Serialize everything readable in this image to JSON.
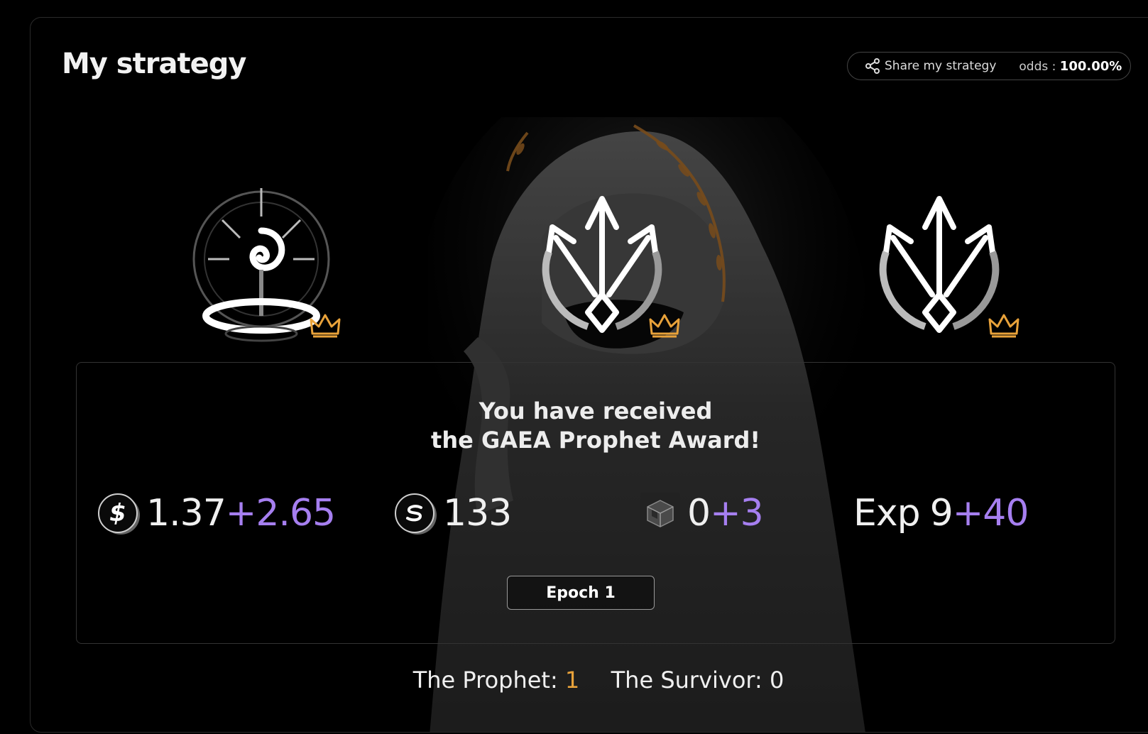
{
  "header": {
    "title": "My strategy",
    "share_label": "Share my strategy",
    "odds_label": "odds :",
    "odds_value": "100.00%"
  },
  "emblems": [
    {
      "name": "spiral-sun-emblem",
      "crown": "crown-icon"
    },
    {
      "name": "trident-emblem",
      "crown": "crown-icon"
    },
    {
      "name": "trident-emblem",
      "crown": "crown-icon"
    }
  ],
  "award": {
    "line1": "You have received",
    "line2": "the GAEA Prophet Award!"
  },
  "stats": {
    "usd": {
      "icon": "dollar-coin-icon",
      "value": "1.37",
      "bonus": "+2.65"
    },
    "soul": {
      "icon": "s-coin-icon",
      "value": "133"
    },
    "box": {
      "icon": "cube-box-icon",
      "value": "0",
      "bonus": "+3"
    },
    "exp": {
      "label": "Exp",
      "value": "9",
      "bonus": "+40"
    }
  },
  "epoch_label": "Epoch 1",
  "footer": {
    "prophet_label": "The Prophet:",
    "prophet_value": "1",
    "survivor_label": "The Survivor:",
    "survivor_value": "0"
  },
  "colors": {
    "accent_purple": "#a67ff0",
    "gold": "#e8a23a",
    "border": "#333333"
  }
}
